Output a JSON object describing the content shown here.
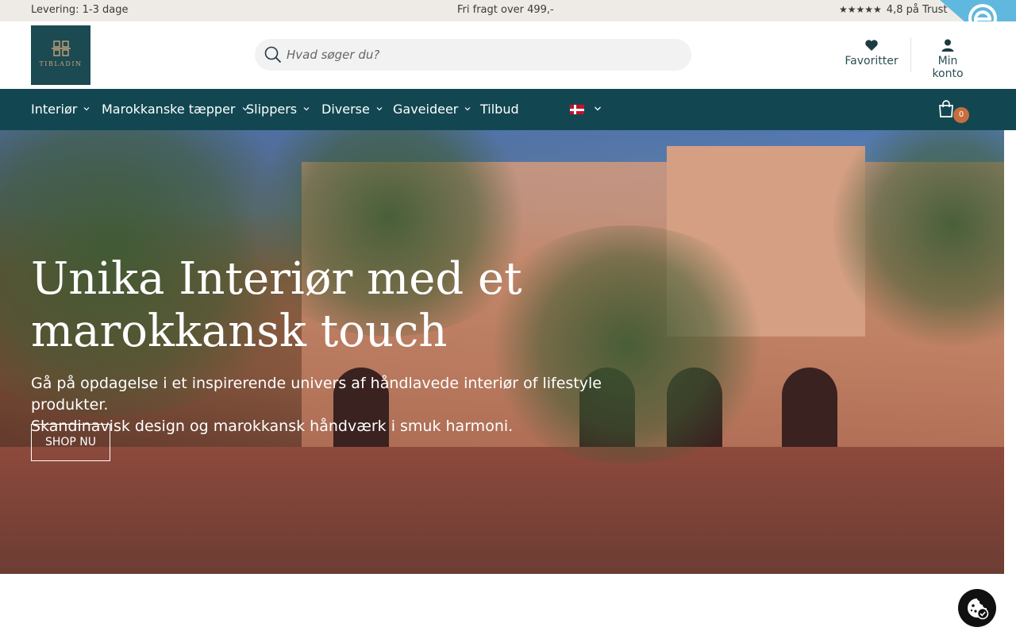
{
  "topbar": {
    "delivery": "Levering: 1-3 dage",
    "free_shipping": "Fri fragt over 499,-",
    "stars": "★★★★★",
    "rating": "4,8 på Trust"
  },
  "header": {
    "logo_text": "TIBLADIN",
    "search_placeholder": "Hvad søger du?",
    "favorites_label": "Favoritter",
    "account_label": "Min konto"
  },
  "nav": {
    "items": [
      {
        "label": "Interiør"
      },
      {
        "label": "Marokkanske tæpper"
      },
      {
        "label": "Slippers"
      },
      {
        "label": "Diverse"
      },
      {
        "label": "Gaveideer"
      },
      {
        "label": "Tilbud"
      }
    ],
    "cart_count": "0"
  },
  "hero": {
    "title": "Unika Interiør med et marokkansk touch",
    "subtitle_line1": "Gå på opdagelse i et inspirerende univers af håndlavede interiør of lifestyle produkter.",
    "subtitle_line2": "Skandinavisk design og marokkansk håndværk i smuk harmoni.",
    "cta_label": "SHOP NU"
  },
  "colors": {
    "nav_bg": "#124752",
    "logo_bg": "#1c4a52",
    "cart_badge": "#c76d3f",
    "topbar_bg": "#eeebe6",
    "badge_blue": "#60b8de"
  },
  "icons": [
    "search-icon",
    "heart-icon",
    "user-icon",
    "chevron-down-icon",
    "cart-icon",
    "danish-flag-icon",
    "cookie-icon",
    "e-mark-icon"
  ]
}
